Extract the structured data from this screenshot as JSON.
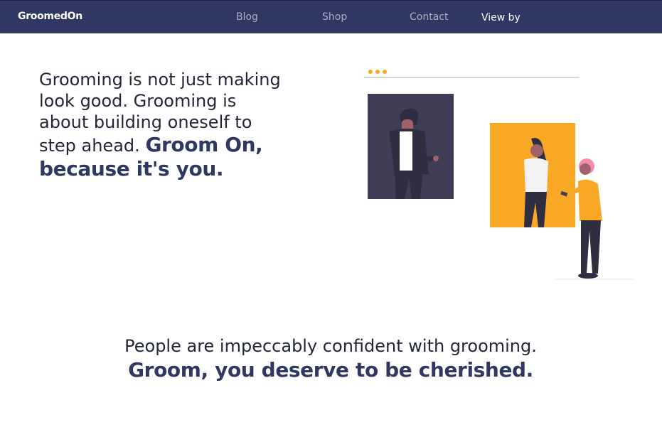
{
  "nav": {
    "brand": "GroomedOn",
    "links": [
      "Blog",
      "Shop",
      "Contact"
    ],
    "view_by": "View by"
  },
  "hero": {
    "text": "Grooming is not just making look good. Grooming is about building oneself to step ahead.",
    "emphasis": "Groom On, because it's you."
  },
  "tagline": {
    "text": "People are impeccably confident with grooming.",
    "emphasis": "Groom, you deserve to be cherished."
  },
  "colors": {
    "navbar": "#2f3862",
    "accent": "#f9a826",
    "dark_panel": "#3f3d56"
  }
}
